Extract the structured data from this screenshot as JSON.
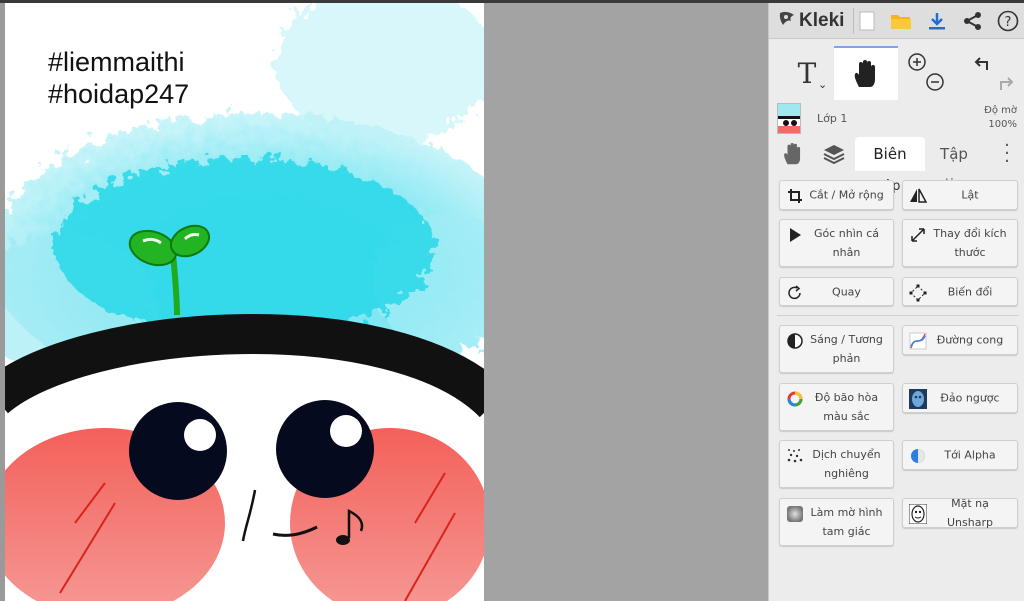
{
  "canvas": {
    "hashtags": [
      "#liemmaithi",
      "#hoidap247"
    ]
  },
  "app": {
    "brand": "Kleki",
    "menu_icons": [
      "kleki-logo-icon",
      "new-file-icon",
      "open-folder-icon",
      "download-icon",
      "share-icon",
      "help-icon"
    ],
    "accent": "#1e6ed6"
  },
  "tools": {
    "text_tool": "T",
    "active": "hand",
    "icons": [
      "text-tool-icon",
      "hand-tool-icon",
      "zoom-in-icon",
      "zoom-out-icon",
      "undo-icon",
      "redo-icon"
    ]
  },
  "layer": {
    "name": "Lớp 1",
    "opacity_label": "Độ mờ",
    "opacity_value": "100%"
  },
  "tabs": {
    "edit_line1": "Biên",
    "edit_line2": "tập",
    "file_line1": "Tập",
    "file_line2": "tin"
  },
  "edit_buttons": {
    "crop": "Cắt / Mở rộng",
    "flip": "Lật",
    "perspective": "Góc nhìn cá nhân",
    "resize": "Thay đổi kích thước",
    "rotate": "Quay",
    "transform": "Biến đổi"
  },
  "filter_buttons": {
    "brightness": "Sáng / Tương phản",
    "curves": "Đường cong",
    "saturation": "Độ bão hòa màu sắc",
    "invert": "Đảo ngược",
    "tilt_shift": "Dịch chuyển nghiêng",
    "to_alpha": "Tới Alpha",
    "triangle_blur": "Làm mờ hình tam giác",
    "unsharp_mask": "Mặt nạ Unsharp"
  }
}
